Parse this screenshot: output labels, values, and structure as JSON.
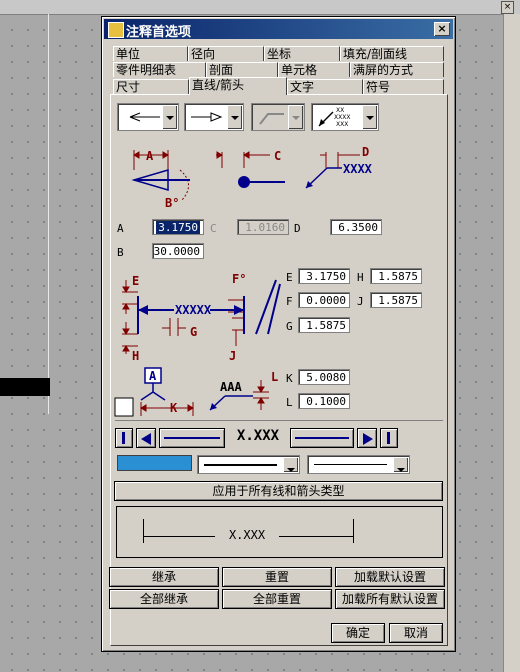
{
  "dialog": {
    "title": "注释首选项",
    "close_label": "×"
  },
  "tabs": {
    "row1": [
      "单位",
      "径向",
      "坐标",
      "填充/剖面线"
    ],
    "row2": [
      "零件明细表",
      "剖面",
      "单元格",
      "满屏的方式"
    ],
    "row3": [
      "尺寸",
      "直线/箭头",
      "文字",
      "符号"
    ],
    "active": "直线/箭头"
  },
  "arrow_type_dropdowns": [
    "left-arrow",
    "right-arrow",
    "leader-disabled",
    "leader-xxx"
  ],
  "diagram_labels": {
    "A": "A",
    "B": "B°",
    "C": "C",
    "D": "D",
    "E": "E",
    "F": "F°",
    "G": "G",
    "H": "H",
    "J": "J",
    "K": "K",
    "L": "L",
    "xxxx": "XXXX",
    "xxxxx": "XXXXX",
    "aaa": "AAA",
    "box_A": "A"
  },
  "fields": {
    "A": {
      "label": "A",
      "value": "3.1750"
    },
    "C": {
      "label": "C",
      "value": "1.0160"
    },
    "D": {
      "label": "D",
      "value": "6.3500"
    },
    "B": {
      "label": "B",
      "value": "30.0000"
    },
    "E": {
      "label": "E",
      "value": "3.1750"
    },
    "H": {
      "label": "H",
      "value": "1.5875"
    },
    "F": {
      "label": "F",
      "value": "0.0000"
    },
    "J": {
      "label": "J",
      "value": "1.5875"
    },
    "G": {
      "label": "G",
      "value": "1.5875"
    },
    "K": {
      "label": "K",
      "value": "5.0080"
    },
    "L": {
      "label": "L",
      "value": "0.1000"
    }
  },
  "dim_bar": {
    "text": "X.XXX"
  },
  "colors": {
    "line_color": "#2b8fd4",
    "diagram_red": "#800000",
    "diagram_blue": "#00008b"
  },
  "apply_all_button": "应用于所有线和箭头类型",
  "preview": {
    "text": "X.XXX"
  },
  "buttons": {
    "inherit": "继承",
    "reset": "重置",
    "load_default": "加载默认设置",
    "inherit_all": "全部继承",
    "reset_all": "全部重置",
    "load_all_default": "加载所有默认设置",
    "ok": "确定",
    "cancel": "取消"
  }
}
